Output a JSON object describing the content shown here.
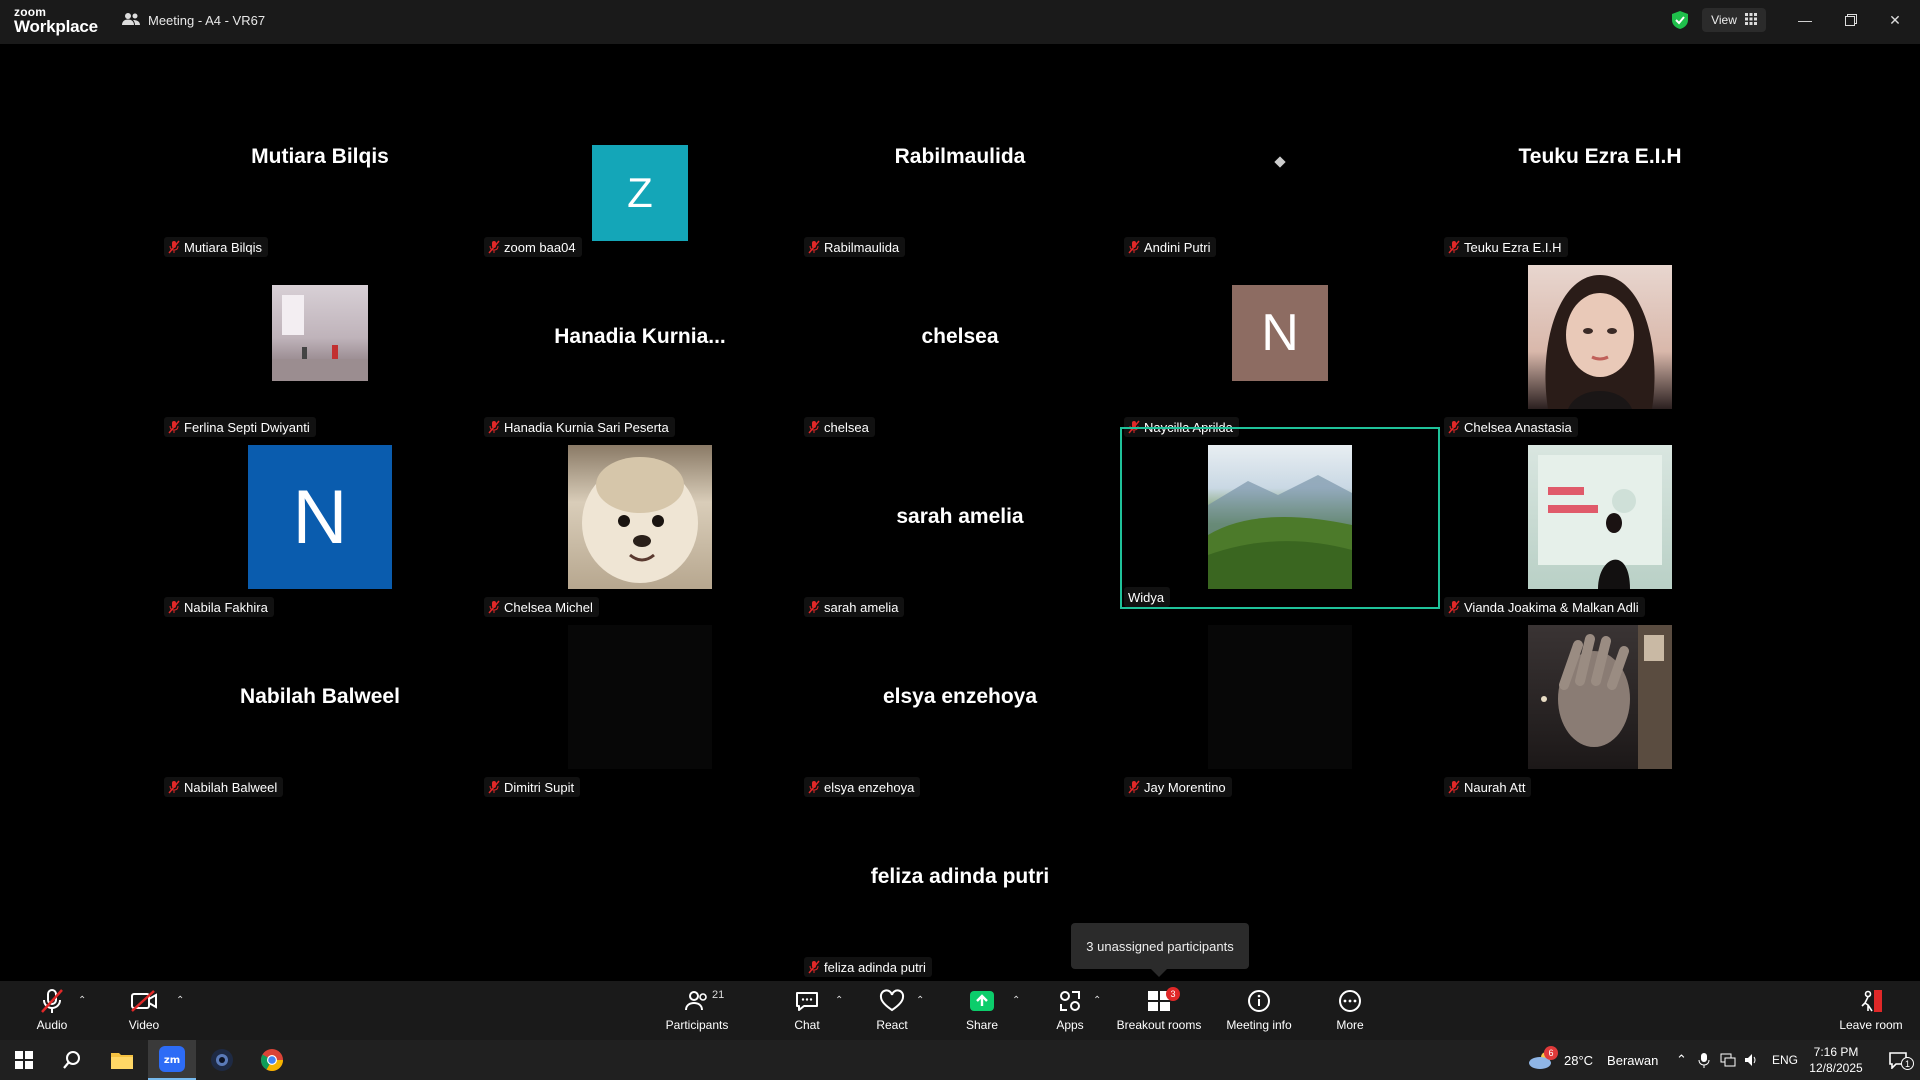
{
  "app": {
    "logo_top": "zoom",
    "logo_bottom": "Workplace",
    "meeting_title": "Meeting - A4 - VR67",
    "view_label": "View"
  },
  "participants": [
    {
      "tile_text": "Mutiara Bilqis",
      "label": "Mutiara Bilqis"
    },
    {
      "tile_text": "Z",
      "label": "zoom baa04",
      "avatar_color": "#14a6b8"
    },
    {
      "tile_text": "Rabilmaulida",
      "label": "Rabilmaulida"
    },
    {
      "tile_text": "",
      "label": "Andini Putri"
    },
    {
      "tile_text": "Teuku Ezra E.I.H",
      "label": "Teuku Ezra E.I.H"
    },
    {
      "tile_text": "",
      "label": "Ferlina Septi Dwiyanti"
    },
    {
      "tile_text": "Hanadia  Kurnia...",
      "label": "Hanadia Kurnia Sari Peserta"
    },
    {
      "tile_text": "chelsea",
      "label": "chelsea"
    },
    {
      "tile_text": "N",
      "label": "Naycilla Aprilda",
      "avatar_color": "#8d6c62"
    },
    {
      "tile_text": "",
      "label": "Chelsea Anastasia"
    },
    {
      "tile_text": "N",
      "label": "Nabila Fakhira",
      "avatar_color": "#0a5cae"
    },
    {
      "tile_text": "",
      "label": "Chelsea Michel"
    },
    {
      "tile_text": "sarah amelia",
      "label": "sarah amelia"
    },
    {
      "tile_text": "",
      "label": "Widya"
    },
    {
      "tile_text": "",
      "label": "Vianda Joakima & Malkan Adli"
    },
    {
      "tile_text": "Nabilah Balweel",
      "label": "Nabilah Balweel"
    },
    {
      "tile_text": "",
      "label": "Dimitri Supit"
    },
    {
      "tile_text": "elsya enzehoya",
      "label": "elsya enzehoya"
    },
    {
      "tile_text": "",
      "label": "Jay Morentino"
    },
    {
      "tile_text": "",
      "label": "Naurah Att"
    },
    {
      "tile_text": "feliza adinda putri",
      "label": "feliza adinda putri"
    }
  ],
  "tooltip": "3 unassigned participants",
  "toolbar": {
    "audio": "Audio",
    "video": "Video",
    "participants": "Participants",
    "participants_count": "21",
    "chat": "Chat",
    "react": "React",
    "share": "Share",
    "apps": "Apps",
    "breakout": "Breakout rooms",
    "breakout_badge": "3",
    "meeting_info": "Meeting info",
    "more": "More",
    "leave": "Leave room"
  },
  "taskbar": {
    "weather_temp": "28°C",
    "weather_desc": "Berawan",
    "weather_badge": "6",
    "lang": "ENG",
    "time": "7:16 PM",
    "date": "12/8/2025",
    "notif_count": "1"
  },
  "colors": {
    "active_border": "#1fc29a",
    "share_green": "#0ccd6b",
    "mute_red": "#e02828"
  }
}
